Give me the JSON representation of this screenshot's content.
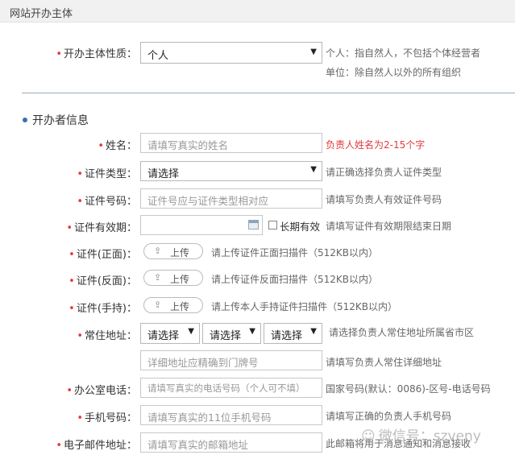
{
  "section": {
    "title": "网站开办主体"
  },
  "entity_type": {
    "label": "开办主体性质：",
    "selected": "个人",
    "hint_line1": "个人：指自然人，不包括个体经营者",
    "hint_line2": "单位：除自然人以外的所有组织"
  },
  "organizer": {
    "heading": "开办者信息",
    "name": {
      "label": "姓名：",
      "placeholder": "请填写真实的姓名",
      "hint": "负责人姓名为2-15个字"
    },
    "id_type": {
      "label": "证件类型：",
      "selected": "请选择",
      "hint": "请正确选择负责人证件类型"
    },
    "id_number": {
      "label": "证件号码：",
      "placeholder": "证件号应与证件类型相对应",
      "hint": "请填写负责人有效证件号码"
    },
    "id_validity": {
      "label": "证件有效期：",
      "checkbox_label": "长期有效",
      "hint": "请填写证件有效期限结束日期"
    },
    "id_front": {
      "label": "证件(正面)：",
      "button": "上传",
      "hint": "请上传证件正面扫描件（512KB以内）"
    },
    "id_back": {
      "label": "证件(反面)：",
      "button": "上传",
      "hint": "请上传证件反面扫描件（512KB以内）"
    },
    "id_handheld": {
      "label": "证件(手持)：",
      "button": "上传",
      "hint": "请上传本人手持证件扫描件（512KB以内）"
    },
    "address": {
      "label": "常住地址：",
      "province": "请选择",
      "city": "请选择",
      "district": "请选择",
      "hint": "请选择负责人常住地址所属省市区",
      "detail_placeholder": "详细地址应精确到门牌号",
      "detail_hint": "请填写负责人常住详细地址"
    },
    "office_phone": {
      "label": "办公室电话：",
      "placeholder": "请填写真实的电话号码（个人可不填）",
      "hint": "国家号码(默认：0086)-区号-电话号码"
    },
    "mobile": {
      "label": "手机号码：",
      "placeholder": "请填写真实的11位手机号码",
      "hint": "请填写正确的负责人手机号码"
    },
    "email": {
      "label": "电子邮件地址：",
      "placeholder": "请填写真实的邮箱地址",
      "hint": "此邮箱将用于消息通知和消息接收"
    }
  },
  "watermark": {
    "text": "微信号：szveny"
  },
  "colors": {
    "required_star": "#e4393c",
    "error_hint": "#e4393c",
    "section_bg": "#f1f1f1"
  }
}
